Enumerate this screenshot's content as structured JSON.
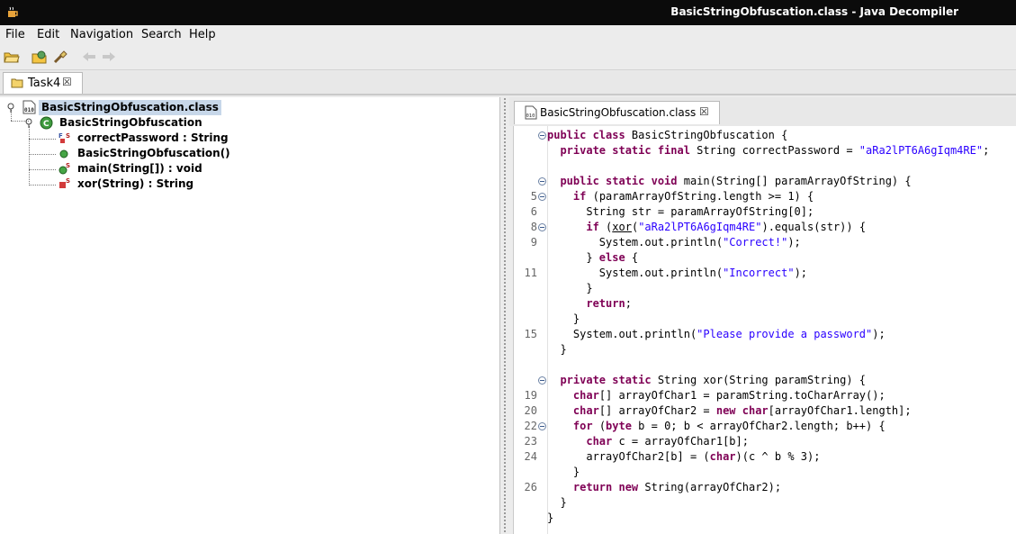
{
  "window": {
    "title": "BasicStringObfuscation.class - Java Decompiler"
  },
  "menu": [
    "File",
    "Edit",
    "Navigation",
    "Search",
    "Help"
  ],
  "toolbar": {
    "icons": [
      "open-file-icon",
      "open-type-icon",
      "search-icon",
      "back-arrow-icon",
      "forward-arrow-icon"
    ]
  },
  "outer_tab": {
    "label": "Task4",
    "close": "☒"
  },
  "tree": [
    {
      "label": "BasicStringObfuscation.class",
      "icon": "class-file-icon",
      "selected": true
    },
    {
      "label": "BasicStringObfuscation",
      "icon": "class-icon"
    },
    {
      "label": "correctPassword : String",
      "icon": "field-final-static-icon"
    },
    {
      "label": "BasicStringObfuscation()",
      "icon": "constructor-icon"
    },
    {
      "label": "main(String[]) : void",
      "icon": "method-static-icon"
    },
    {
      "label": "xor(String) : String",
      "icon": "private-static-method-icon"
    }
  ],
  "editor_tab": {
    "label": "BasicStringObfuscation.class",
    "close": "☒"
  },
  "code": [
    {
      "no": "",
      "fold": true,
      "tokens": [
        [
          "kw",
          "public class "
        ],
        [
          "plain",
          "BasicStringObfuscation {"
        ]
      ]
    },
    {
      "no": "",
      "fold": false,
      "tokens": [
        [
          "plain",
          "  "
        ],
        [
          "kw",
          "private static final "
        ],
        [
          "plain",
          "String correctPassword = "
        ],
        [
          "str",
          "\"aRa2lPT6A6gIqm4RE\""
        ],
        [
          "plain",
          ";"
        ]
      ]
    },
    {
      "no": "",
      "fold": false,
      "tokens": []
    },
    {
      "no": "",
      "fold": true,
      "tokens": [
        [
          "plain",
          "  "
        ],
        [
          "kw",
          "public static void "
        ],
        [
          "plain",
          "main(String[] paramArrayOfString) {"
        ]
      ]
    },
    {
      "no": "5",
      "fold": true,
      "tokens": [
        [
          "plain",
          "    "
        ],
        [
          "kw",
          "if "
        ],
        [
          "plain",
          "(paramArrayOfString.length >= 1) {"
        ]
      ]
    },
    {
      "no": "6",
      "fold": false,
      "tokens": [
        [
          "plain",
          "      String str = paramArrayOfString[0];"
        ]
      ]
    },
    {
      "no": "8",
      "fold": true,
      "tokens": [
        [
          "plain",
          "      "
        ],
        [
          "kw",
          "if "
        ],
        [
          "plain",
          "("
        ],
        [
          "ul",
          "xor"
        ],
        [
          "plain",
          "("
        ],
        [
          "str",
          "\"aRa2lPT6A6gIqm4RE\""
        ],
        [
          "plain",
          ").equals(str)) {"
        ]
      ]
    },
    {
      "no": "9",
      "fold": false,
      "tokens": [
        [
          "plain",
          "        System.out.println("
        ],
        [
          "str",
          "\"Correct!\""
        ],
        [
          "plain",
          ");"
        ]
      ]
    },
    {
      "no": "",
      "fold": false,
      "tokens": [
        [
          "plain",
          "      } "
        ],
        [
          "kw",
          "else "
        ],
        [
          "plain",
          "{"
        ]
      ]
    },
    {
      "no": "11",
      "fold": false,
      "tokens": [
        [
          "plain",
          "        System.out.println("
        ],
        [
          "str",
          "\"Incorrect\""
        ],
        [
          "plain",
          ");"
        ]
      ]
    },
    {
      "no": "",
      "fold": false,
      "tokens": [
        [
          "plain",
          "      }"
        ]
      ]
    },
    {
      "no": "",
      "fold": false,
      "tokens": [
        [
          "plain",
          "      "
        ],
        [
          "kw",
          "return"
        ],
        [
          "plain",
          ";"
        ]
      ]
    },
    {
      "no": "",
      "fold": false,
      "tokens": [
        [
          "plain",
          "    }"
        ]
      ]
    },
    {
      "no": "15",
      "fold": false,
      "tokens": [
        [
          "plain",
          "    System.out.println("
        ],
        [
          "str",
          "\"Please provide a password\""
        ],
        [
          "plain",
          ");"
        ]
      ]
    },
    {
      "no": "",
      "fold": false,
      "tokens": [
        [
          "plain",
          "  }"
        ]
      ]
    },
    {
      "no": "",
      "fold": false,
      "tokens": []
    },
    {
      "no": "",
      "fold": true,
      "tokens": [
        [
          "plain",
          "  "
        ],
        [
          "kw",
          "private static "
        ],
        [
          "plain",
          "String xor(String paramString) {"
        ]
      ]
    },
    {
      "no": "19",
      "fold": false,
      "tokens": [
        [
          "plain",
          "    "
        ],
        [
          "kw",
          "char"
        ],
        [
          "plain",
          "[] arrayOfChar1 = paramString.toCharArray();"
        ]
      ]
    },
    {
      "no": "20",
      "fold": false,
      "tokens": [
        [
          "plain",
          "    "
        ],
        [
          "kw",
          "char"
        ],
        [
          "plain",
          "[] arrayOfChar2 = "
        ],
        [
          "kw",
          "new char"
        ],
        [
          "plain",
          "[arrayOfChar1.length];"
        ]
      ]
    },
    {
      "no": "22",
      "fold": true,
      "tokens": [
        [
          "plain",
          "    "
        ],
        [
          "kw",
          "for "
        ],
        [
          "plain",
          "("
        ],
        [
          "kw",
          "byte "
        ],
        [
          "plain",
          "b = 0; b < arrayOfChar2.length; b++) {"
        ]
      ]
    },
    {
      "no": "23",
      "fold": false,
      "tokens": [
        [
          "plain",
          "      "
        ],
        [
          "kw",
          "char "
        ],
        [
          "plain",
          "c = arrayOfChar1[b];"
        ]
      ]
    },
    {
      "no": "24",
      "fold": false,
      "tokens": [
        [
          "plain",
          "      arrayOfChar2[b] = ("
        ],
        [
          "kw",
          "char"
        ],
        [
          "plain",
          ")(c ^ b % 3);"
        ]
      ]
    },
    {
      "no": "",
      "fold": false,
      "tokens": [
        [
          "plain",
          "    }"
        ]
      ]
    },
    {
      "no": "26",
      "fold": false,
      "tokens": [
        [
          "plain",
          "    "
        ],
        [
          "kw",
          "return new "
        ],
        [
          "plain",
          "String(arrayOfChar2);"
        ]
      ]
    },
    {
      "no": "",
      "fold": false,
      "tokens": [
        [
          "plain",
          "  }"
        ]
      ]
    },
    {
      "no": "",
      "fold": false,
      "tokens": [
        [
          "plain",
          "}"
        ]
      ]
    }
  ]
}
